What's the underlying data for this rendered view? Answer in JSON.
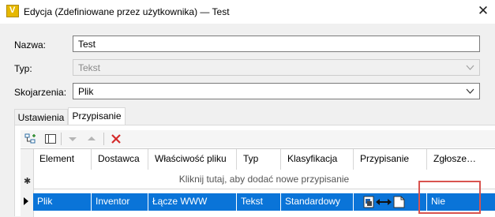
{
  "window": {
    "title": "Edycja (Zdefiniowane przez użytkownika) — Test",
    "app_icon_letter": "V"
  },
  "form": {
    "nazwa_label": "Nazwa:",
    "nazwa_value": "Test",
    "typ_label": "Typ:",
    "typ_value": "Tekst",
    "skojarzenia_label": "Skojarzenia:",
    "skojarzenia_value": "Plik"
  },
  "tabs": [
    {
      "label": "Ustawienia",
      "active": false
    },
    {
      "label": "Przypisanie",
      "active": true
    }
  ],
  "toolbar": {
    "icons": [
      "tree-add-icon",
      "panel-icon",
      "arrow-down-icon",
      "arrow-up-icon",
      "delete-icon"
    ]
  },
  "grid": {
    "columns": [
      "Element",
      "Dostawca",
      "Właściwość pliku",
      "Typ",
      "Klasyfikacja",
      "Przypisanie",
      "Zgłosze…"
    ],
    "new_row_text": "Kliknij tutaj, aby dodać nowe przypisanie",
    "new_row_marker": "✱",
    "rows": [
      {
        "element": "Plik",
        "dostawca": "Inventor",
        "wlasciwosc": "Łącze WWW",
        "typ": "Tekst",
        "klasyfikacja": "Standardowy",
        "przypisanie_icons": [
          "document-icon",
          "bidirectional-arrow-icon",
          "page-icon"
        ],
        "zgloszenie": "Nie"
      }
    ]
  },
  "colors": {
    "selection": "#0a74d8",
    "highlight_box": "#d9534f",
    "app_icon": "#e6b800"
  }
}
